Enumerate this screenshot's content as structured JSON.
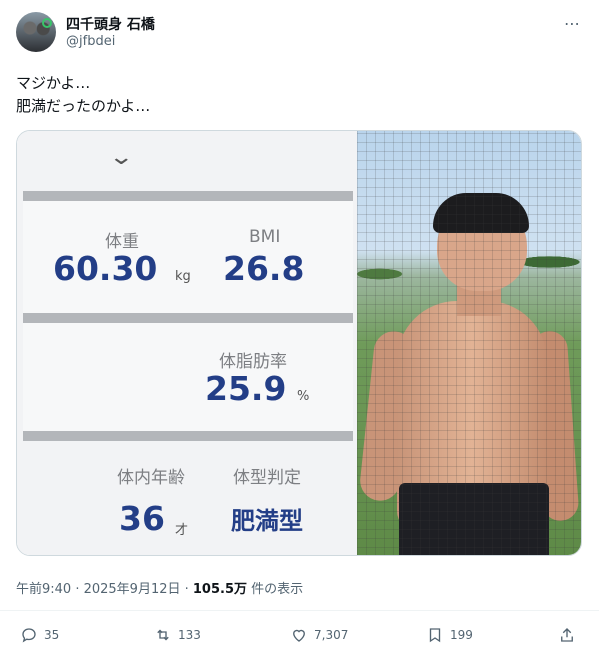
{
  "author": {
    "name": "四千頭身 石橋",
    "handle": "@jfbdei"
  },
  "more_icon": "⋯",
  "text_lines": [
    "マジかよ…",
    "肥満だったのかよ…"
  ],
  "scale_panel": {
    "weight_label": "体重",
    "weight_value": "60.30",
    "weight_unit": "kg",
    "bmi_label": "BMI",
    "bmi_value": "26.8",
    "body_fat_label": "体脂肪率",
    "body_fat_value": "25.9",
    "body_fat_unit": "%",
    "body_age_label": "体内年齢",
    "body_age_value": "36",
    "body_age_unit": "才",
    "body_type_label": "体型判定",
    "body_type_value": "肥満型"
  },
  "meta": {
    "time": "午前9:40 · 2025年9月12日 · ",
    "views": "105.5万",
    "views_suffix": " 件の表示"
  },
  "actions": {
    "replies": "35",
    "reposts": "133",
    "likes": "7,307",
    "bookmarks": "199"
  },
  "colors": {
    "value_blue": "#233e87",
    "accent": "#1d9bf0"
  }
}
